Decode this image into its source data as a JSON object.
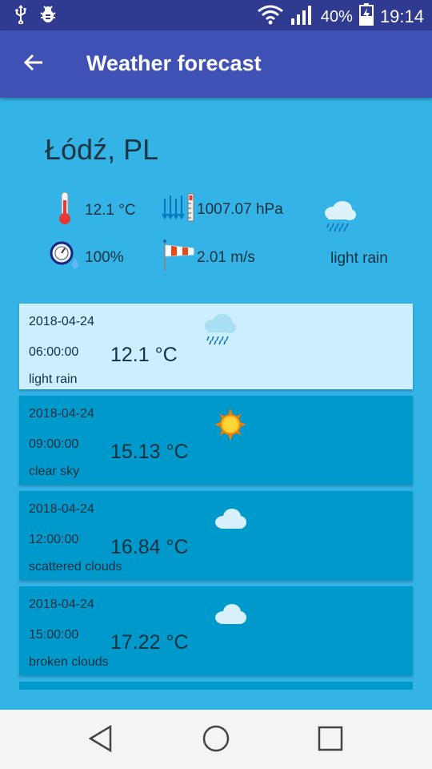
{
  "status_bar": {
    "battery": "40%",
    "time": "19:14",
    "icons": [
      "usb-icon",
      "bug-icon",
      "wifi-icon",
      "signal-icon",
      "battery-charging-icon"
    ]
  },
  "app_bar": {
    "title": "Weather forecast"
  },
  "current": {
    "city": "Łódź, PL",
    "temperature": "12.1 °C",
    "pressure": "1007.07 hPa",
    "humidity": "100%",
    "wind": "2.01 m/s",
    "description": "light rain",
    "icons": [
      "thermometer-icon",
      "pressure-icon",
      "rain-cloud-icon",
      "humidity-icon",
      "windsock-icon"
    ]
  },
  "forecast": [
    {
      "date": "2018-04-24",
      "time": "06:00:00",
      "temp": "12.1 °C",
      "desc": "light rain",
      "icon": "rain-cloud-icon"
    },
    {
      "date": "2018-04-24",
      "time": "09:00:00",
      "temp": "15.13 °C",
      "desc": "clear sky",
      "icon": "sun-icon"
    },
    {
      "date": "2018-04-24",
      "time": "12:00:00",
      "temp": "16.84 °C",
      "desc": "scattered clouds",
      "icon": "cloud-icon"
    },
    {
      "date": "2018-04-24",
      "time": "15:00:00",
      "temp": "17.22 °C",
      "desc": "broken clouds",
      "icon": "cloud-icon"
    }
  ],
  "nav_bar": {
    "icons": [
      "back-triangle-icon",
      "home-circle-icon",
      "recents-square-icon"
    ]
  },
  "colors": {
    "status_bar": "#2f3a91",
    "app_bar": "#3f51b5",
    "background": "#33b3e6",
    "card": "#0099cc",
    "card_selected": "#ccefff"
  }
}
